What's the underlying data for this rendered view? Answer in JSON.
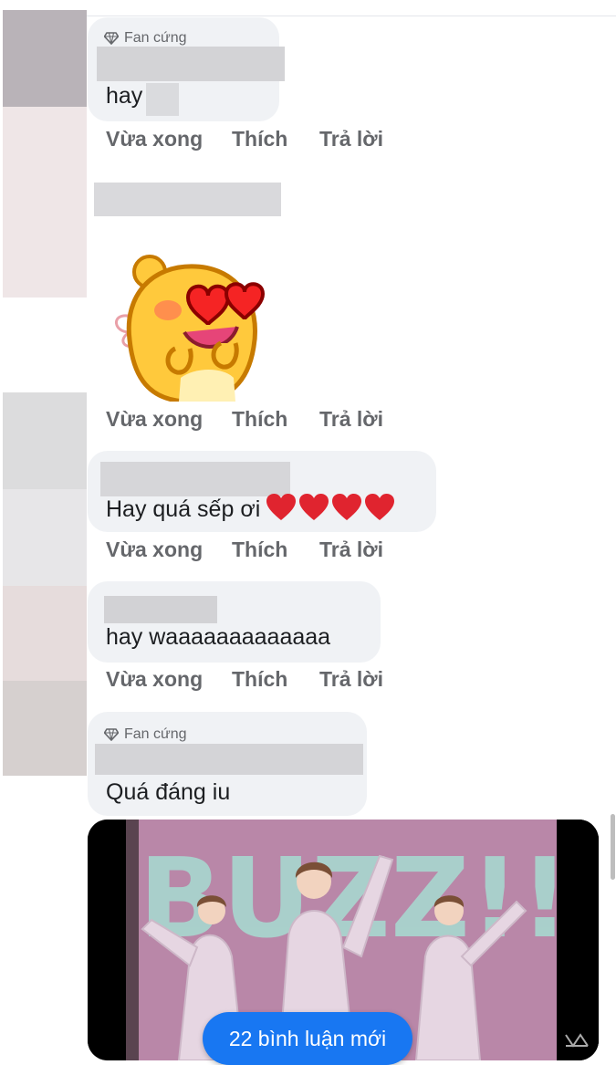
{
  "comments": [
    {
      "badge": "Fan cứng",
      "text": "hay"
    },
    {
      "sticker": "love-eyes-sticker"
    },
    {
      "text": "Hay quá sếp ơi"
    },
    {
      "text": "hay waaaaaaaaaaaaa"
    },
    {
      "badge": "Fan cứng",
      "text": "Quá đáng iu"
    }
  ],
  "actions": {
    "time": "Vừa xong",
    "like": "Thích",
    "reply": "Trả lời"
  },
  "video": {
    "title_art": "BUZZ!!",
    "new_comments_label": "22 bình luận mới"
  },
  "colors": {
    "bubble": "#f0f2f5",
    "action_text": "#65676b",
    "accent": "#1877f2",
    "heart": "#e0242f"
  }
}
